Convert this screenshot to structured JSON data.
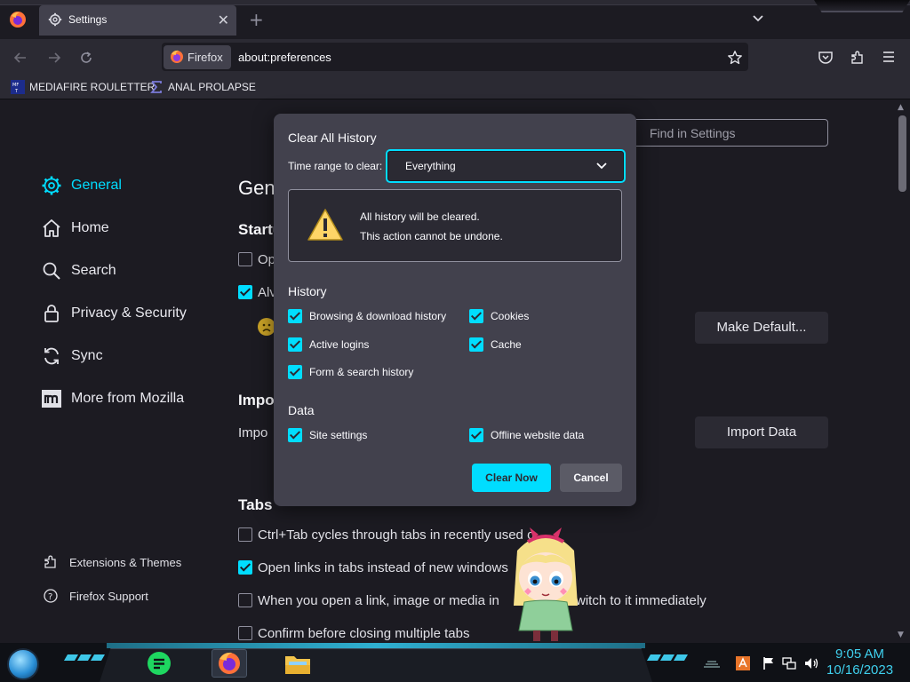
{
  "browser": {
    "tab_title": "Settings",
    "identity_label": "Firefox",
    "url": "about:preferences",
    "bookmarks": [
      {
        "label": "MEDIAFIRE ROULETTER"
      },
      {
        "label": "ANAL PROLAPSE"
      }
    ]
  },
  "settings": {
    "search_placeholder": "Find in Settings",
    "categories": [
      {
        "label": "General",
        "icon": "gear-icon",
        "selected": true
      },
      {
        "label": "Home",
        "icon": "home-icon"
      },
      {
        "label": "Search",
        "icon": "search-icon"
      },
      {
        "label": "Privacy & Security",
        "icon": "lock-icon"
      },
      {
        "label": "Sync",
        "icon": "sync-icon"
      },
      {
        "label": "More from Mozilla",
        "icon": "mozilla-icon"
      }
    ],
    "footer": {
      "extensions": "Extensions & Themes",
      "support": "Firefox Support"
    },
    "page_title_partial": "Gene",
    "startup_heading_partial": "Startu",
    "startup_opt1_partial": "Op",
    "startup_opt2_partial": "Alv",
    "import_heading_partial": "Impo",
    "import_text_partial": "Impo",
    "make_default": "Make Default...",
    "import_data": "Import Data",
    "tabs_heading": "Tabs",
    "tabs_options": [
      {
        "label": "Ctrl+Tab cycles through tabs in recently used o",
        "checked": false
      },
      {
        "label": "Open links in tabs instead of new windows",
        "checked": true
      },
      {
        "label": "When you open a link, image or media in",
        "tail": "witch to it immediately",
        "checked": false
      },
      {
        "label": "Confirm before closing multiple tabs",
        "checked": false
      }
    ]
  },
  "dialog": {
    "title": "Clear All History",
    "range_label": "Time range to clear:",
    "range_value": "Everything",
    "warning_line1": "All history will be cleared.",
    "warning_line2": "This action cannot be undone.",
    "history_heading": "History",
    "history_items": [
      {
        "label": "Browsing & download history",
        "checked": true
      },
      {
        "label": "Cookies",
        "checked": true
      },
      {
        "label": "Active logins",
        "checked": true
      },
      {
        "label": "Cache",
        "checked": true
      },
      {
        "label": "Form & search history",
        "checked": true
      }
    ],
    "data_heading": "Data",
    "data_items": [
      {
        "label": "Site settings",
        "checked": true
      },
      {
        "label": "Offline website data",
        "checked": true
      }
    ],
    "clear_button": "Clear Now",
    "cancel_button": "Cancel"
  },
  "taskbar": {
    "time": "9:05 AM",
    "date": "10/16/2023"
  },
  "colors": {
    "accent": "#00ddff",
    "dialog_bg": "#42414d",
    "page_bg": "#1c1b22"
  }
}
